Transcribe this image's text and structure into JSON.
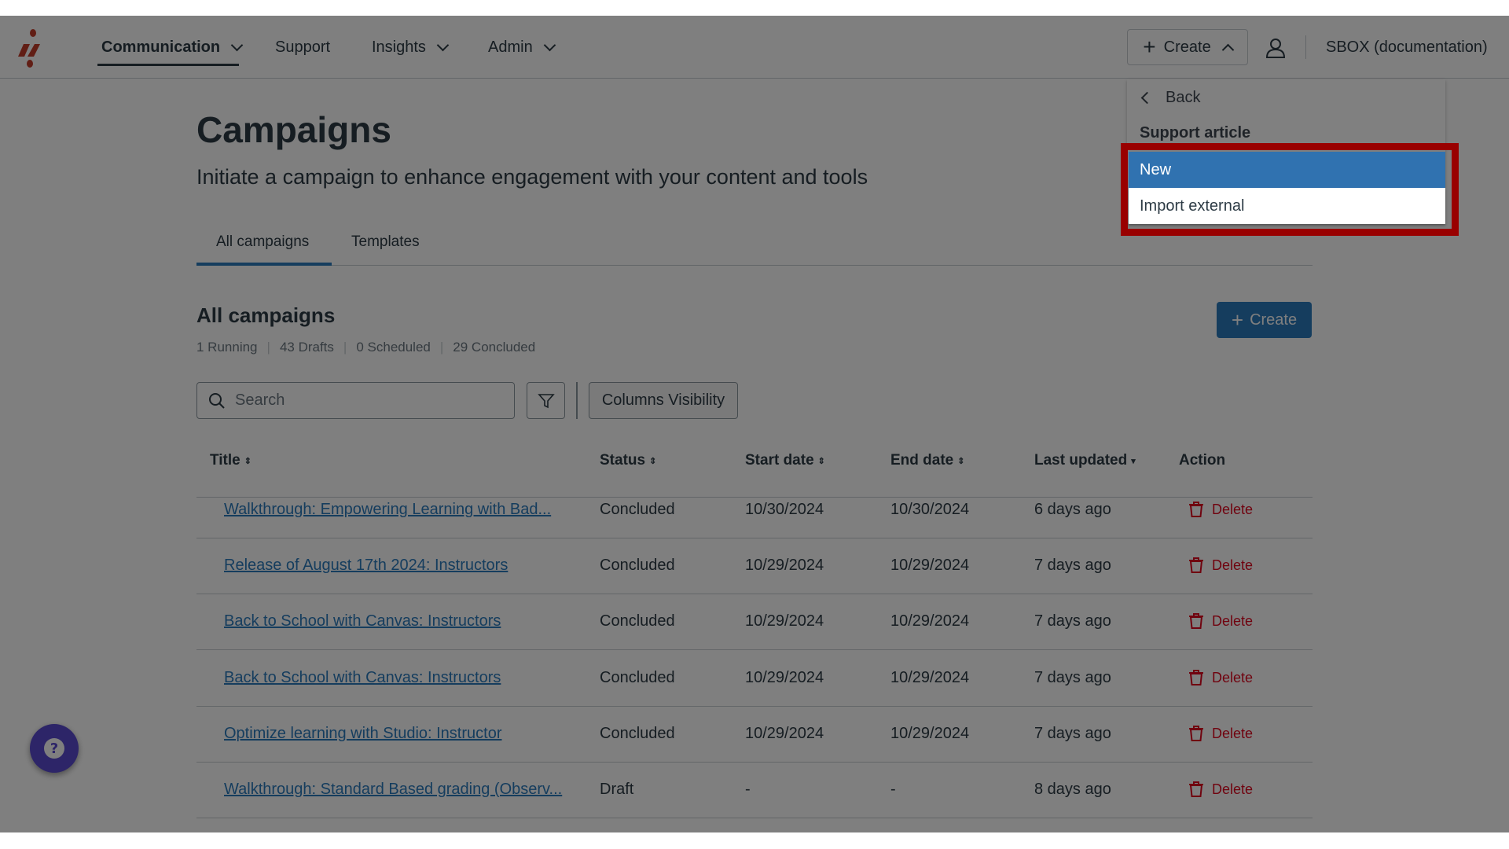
{
  "nav": {
    "items": [
      {
        "label": "Communication",
        "dropdown": true,
        "active": true
      },
      {
        "label": "Support",
        "dropdown": false
      },
      {
        "label": "Insights",
        "dropdown": true
      },
      {
        "label": "Admin",
        "dropdown": true
      }
    ],
    "create_label": "Create",
    "account_label": "SBOX (documentation)"
  },
  "page": {
    "title": "Campaigns",
    "subtitle": "Initiate a campaign to enhance engagement with your content and tools",
    "tabs": [
      "All campaigns",
      "Templates"
    ],
    "section_title": "All campaigns",
    "stats": [
      "1 Running",
      "43 Drafts",
      "0 Scheduled",
      "29 Concluded"
    ],
    "create_label": "Create",
    "search_placeholder": "Search",
    "columns_visibility_label": "Columns Visibility"
  },
  "table": {
    "headers": [
      "Title",
      "Status",
      "Start date",
      "End date",
      "Last updated",
      "Action"
    ],
    "rows": [
      {
        "title": "Walkthrough: Empowering Learning with Bad...",
        "status": "Concluded",
        "start": "10/30/2024",
        "end": "10/30/2024",
        "updated": "6 days ago",
        "action": "Delete"
      },
      {
        "title": "Release of August 17th 2024: Instructors",
        "status": "Concluded",
        "start": "10/29/2024",
        "end": "10/29/2024",
        "updated": "7 days ago",
        "action": "Delete"
      },
      {
        "title": "Back to School with Canvas: Instructors",
        "status": "Concluded",
        "start": "10/29/2024",
        "end": "10/29/2024",
        "updated": "7 days ago",
        "action": "Delete"
      },
      {
        "title": "Back to School with Canvas: Instructors",
        "status": "Concluded",
        "start": "10/29/2024",
        "end": "10/29/2024",
        "updated": "7 days ago",
        "action": "Delete"
      },
      {
        "title": "Optimize learning with Studio: Instructor",
        "status": "Concluded",
        "start": "10/29/2024",
        "end": "10/29/2024",
        "updated": "7 days ago",
        "action": "Delete"
      },
      {
        "title": "Walkthrough: Standard Based grading (Observ...",
        "status": "Draft",
        "start": "-",
        "end": "-",
        "updated": "8 days ago",
        "action": "Delete"
      }
    ]
  },
  "menu": {
    "back_label": "Back",
    "group_label": "Support article",
    "items": [
      "New",
      "Import external"
    ],
    "highlighted": "New"
  },
  "colors": {
    "accent": "#2b7abc",
    "danger": "#e0061f",
    "menu_highlight": "#3072b0",
    "annotation": "#990000",
    "logo": "#c23c2a"
  }
}
